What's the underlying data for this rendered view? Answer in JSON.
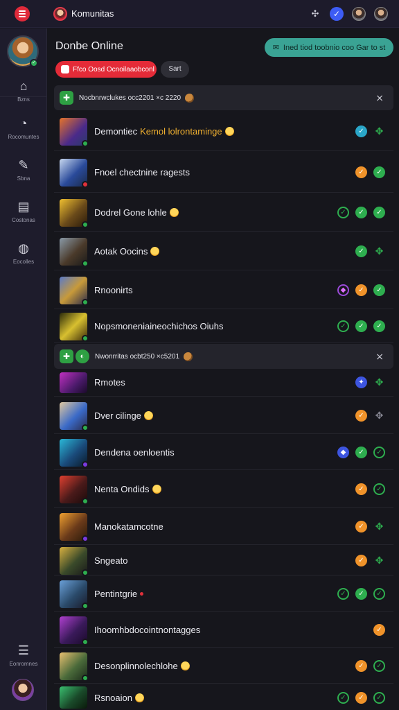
{
  "app": {
    "title": "Komunitas"
  },
  "sidebar": {
    "items": [
      {
        "label": "Bzns",
        "icon": "home-icon"
      },
      {
        "label": "Rocomuntes",
        "icon": "compass-icon"
      },
      {
        "label": "Sbna",
        "icon": "pencil-icon"
      },
      {
        "label": "Costonas",
        "icon": "calendar-icon"
      },
      {
        "label": "Eocolles",
        "icon": "globe-icon"
      }
    ],
    "bottom_item": {
      "label": "Eonromnes",
      "icon": "stack-icon"
    }
  },
  "header": {
    "title": "Donbe Online",
    "green_button": "Ined tiod toobnio coo Gar to st",
    "red_pill": "Ffco Oosd Ocnoilaaobconl",
    "sort_pill": "Sart"
  },
  "sections": [
    {
      "title": "Nocbnrwclukes occ2201 ×c 2220"
    },
    {
      "title": "Nwonrritas ocbt250 ×c5201"
    }
  ],
  "rows": [
    {
      "name": "Demontiec",
      "extra": "Kemol lolrontaminge"
    },
    {
      "name": "Fnoel chectnine ragests"
    },
    {
      "name": "Dodrel Gone lohle"
    },
    {
      "name": "Aotak Oocins"
    },
    {
      "name": "Rnoonirts"
    },
    {
      "name": "Nopsmoneniaineochichos Oiuhs"
    },
    {
      "name": "Rmotes"
    },
    {
      "name": "Dver cilinge"
    },
    {
      "name": "Dendena oenloentis"
    },
    {
      "name": "Nenta Ondids"
    },
    {
      "name": "Manokatamcotne"
    },
    {
      "name": "Sngeato"
    },
    {
      "name": "Pentintgrie"
    },
    {
      "name": "Ihoomhbdocointnontagges"
    },
    {
      "name": "Desonplinnolechlohe"
    },
    {
      "name": "Rsnoaion"
    }
  ],
  "colors": {
    "accent_red": "#e42b38",
    "accent_teal": "#3aa394",
    "status_orange": "#f0932a",
    "status_green": "#2eae4f"
  }
}
